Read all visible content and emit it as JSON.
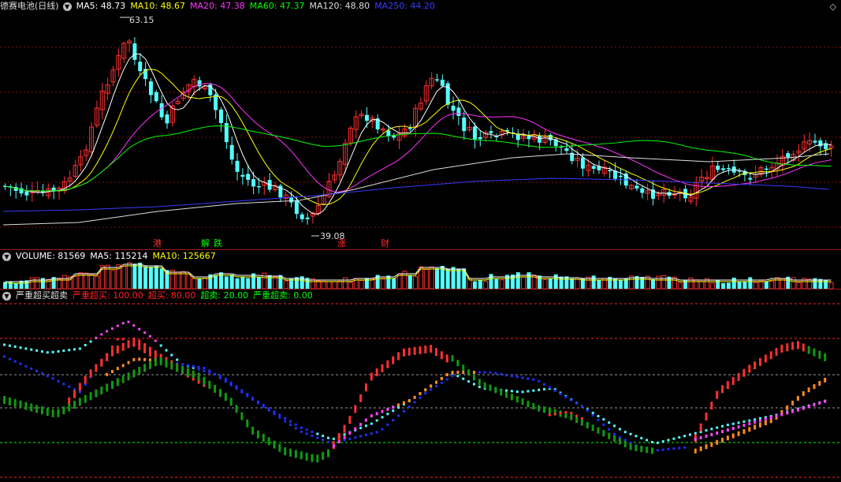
{
  "main": {
    "title": "德赛电池(日线)",
    "ma": [
      {
        "label": "MA5: 48.73",
        "color": "#ffffff"
      },
      {
        "label": "MA10: 48.67",
        "color": "#ffff00"
      },
      {
        "label": "MA20: 47.38",
        "color": "#ff33ff"
      },
      {
        "label": "MA60: 47.37",
        "color": "#00ff00"
      },
      {
        "label": "MA120: 48.80",
        "color": "#dddddd"
      },
      {
        "label": "MA250: 44.20",
        "color": "#3a3aff"
      }
    ],
    "high_label": "63.15",
    "low_label": "39.08",
    "events": [
      "港",
      "解",
      "跌",
      "涨",
      "财"
    ]
  },
  "volume": {
    "ma": [
      {
        "label": "VOLUME: 81569",
        "color": "#ffffff"
      },
      {
        "label": "MA5: 115214",
        "color": "#ffffff"
      },
      {
        "label": "MA10: 125667",
        "color": "#ffff00"
      }
    ]
  },
  "indicator": {
    "title": "严重超买超卖",
    "items": [
      {
        "label": "严重超买: 100.00",
        "color": "#ff2020"
      },
      {
        "label": "超买: 80.00",
        "color": "#ff2020"
      },
      {
        "label": "超卖: 20.00",
        "color": "#00ff00"
      },
      {
        "label": "严重超卖: 0.00",
        "color": "#00ff00"
      }
    ]
  },
  "colors": {
    "up": "#ff3030",
    "down": "#54ffff",
    "grid": "#7a1010"
  }
}
